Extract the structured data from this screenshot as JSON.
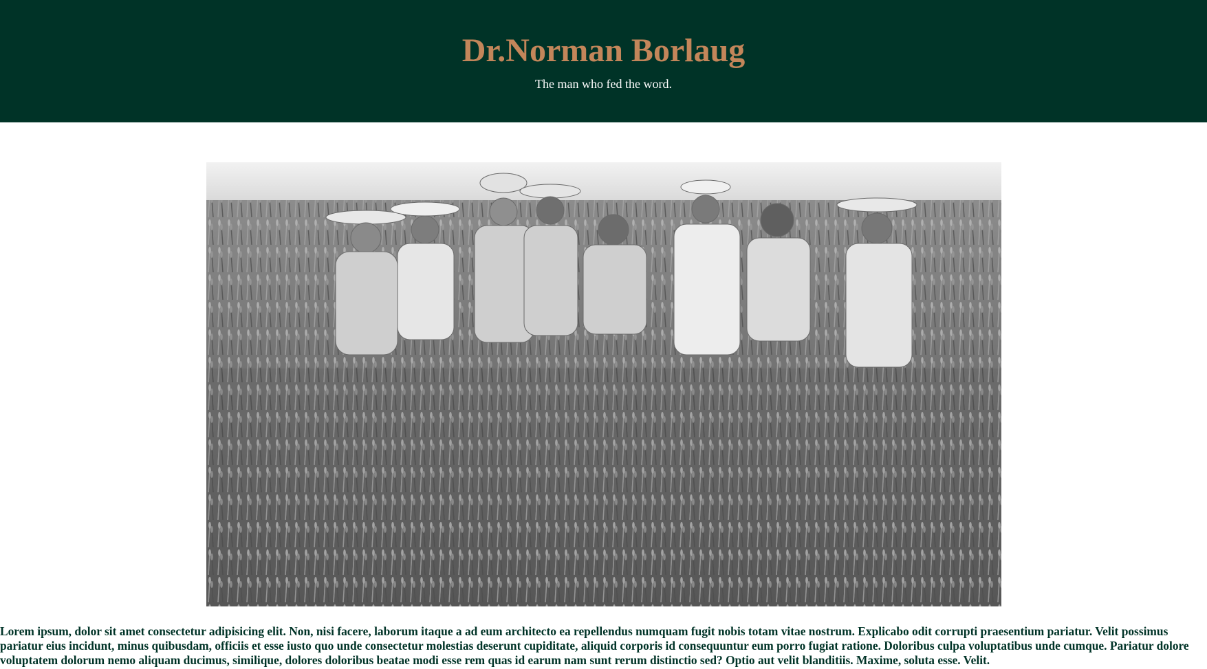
{
  "header": {
    "title": "Dr.Norman Borlaug",
    "subtitle": "The man who fed the word."
  },
  "photo": {
    "description_icon": "wheat-field-group-photo"
  },
  "content": {
    "paragraph": "Lorem ipsum, dolor sit amet consectetur adipisicing elit. Non, nisi facere, laborum itaque a ad eum architecto ea repellendus numquam fugit nobis totam vitae nostrum. Explicabo odit corrupti praesentium pariatur. Velit possimus pariatur eius incidunt, minus quibusdam, officiis et esse iusto quo unde consectetur molestias deserunt cupiditate, aliquid corporis id consequuntur eum porro fugiat ratione. Doloribus culpa voluptatibus unde cumque. Pariatur dolore voluptatem dolorum nemo aliquam ducimus, similique, dolores doloribus beatae modi esse rem quas id earum nam sunt rerum distinctio sed? Optio aut velit blanditiis. Maxime, soluta esse. Velit."
  },
  "colors": {
    "header_bg": "#003327",
    "title": "#C3865A",
    "subtitle": "#ffffff",
    "body_text": "#003327"
  }
}
